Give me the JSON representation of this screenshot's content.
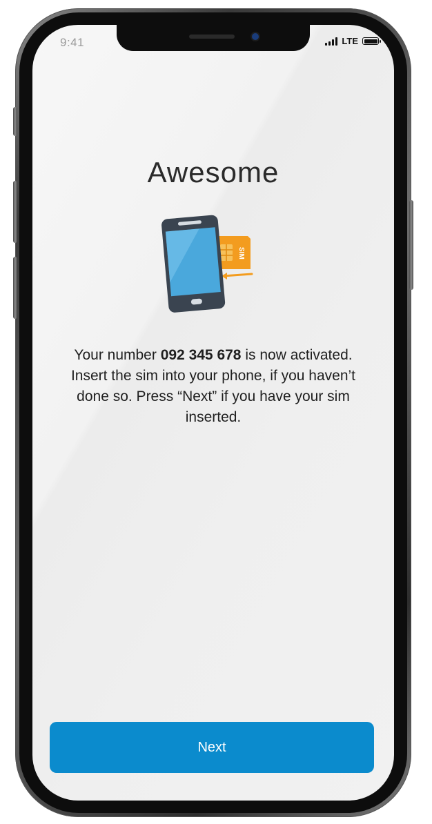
{
  "status_bar": {
    "time": "9:41",
    "network": "LTE"
  },
  "screen": {
    "title": "Awesome",
    "message": {
      "part1": "Your number ",
      "number": "092 345 678",
      "part2": " is now activated.",
      "line2": "Insert the sim into your phone, if you haven’t done so. Press “Next” if you have your sim inserted."
    },
    "illustration": {
      "sim_label": "SIM",
      "icon": "phone-sim-insert-icon"
    }
  },
  "actions": {
    "next_label": "Next"
  },
  "colors": {
    "accent": "#0b8bcd",
    "sim_orange": "#f39c1f",
    "phone_screen": "#4aa8dc",
    "phone_body": "#3a4450"
  }
}
